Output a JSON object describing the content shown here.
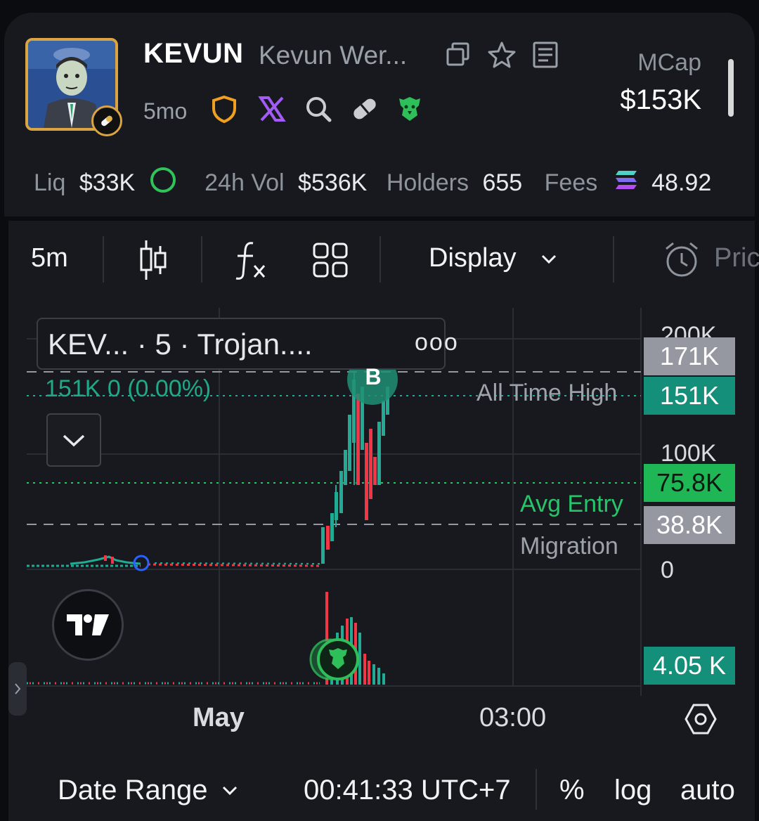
{
  "token": {
    "ticker": "KEVUN",
    "name": "Kevun Wer...",
    "age": "5mo",
    "mcap_label": "MCap",
    "mcap_value": "$153K"
  },
  "stats": {
    "liq_label": "Liq",
    "liq_value": "$33K",
    "vol_label": "24h Vol",
    "vol_value": "$536K",
    "holders_label": "Holders",
    "holders_value": "655",
    "fees_label": "Fees",
    "fees_value": "48.92"
  },
  "toolbar": {
    "interval": "5m",
    "display_label": "Display",
    "price_label": "Pric"
  },
  "chart": {
    "legend_text": "KEV...   · 5 · Trojan....",
    "legend_more": "ooo",
    "ohlc_text": "151K  0 (0.00%)",
    "buy_marker": "B",
    "ath_label": "All Time High",
    "avg_entry_label": "Avg Entry",
    "migration_label": "Migration",
    "axis_top": "200K",
    "axis_mid": "100K",
    "axis_zero": "0",
    "tag_171k": "171K",
    "tag_151k": "151K",
    "tag_758k": "75.8K",
    "tag_388k": "38.8K",
    "tag_volume": "4.05 K",
    "time_may": "May",
    "time_0300": "03:00",
    "colors": {
      "up": "#22ab94",
      "down": "#f23645",
      "avg_entry": "#27c46a",
      "tag_grey": "#9598a1",
      "tag_teal": "#14907a",
      "tag_green": "#1fb655"
    }
  },
  "footer": {
    "date_range": "Date Range",
    "clock": "00:41:33 UTC+7",
    "percent": "%",
    "log": "log",
    "auto": "auto"
  }
}
